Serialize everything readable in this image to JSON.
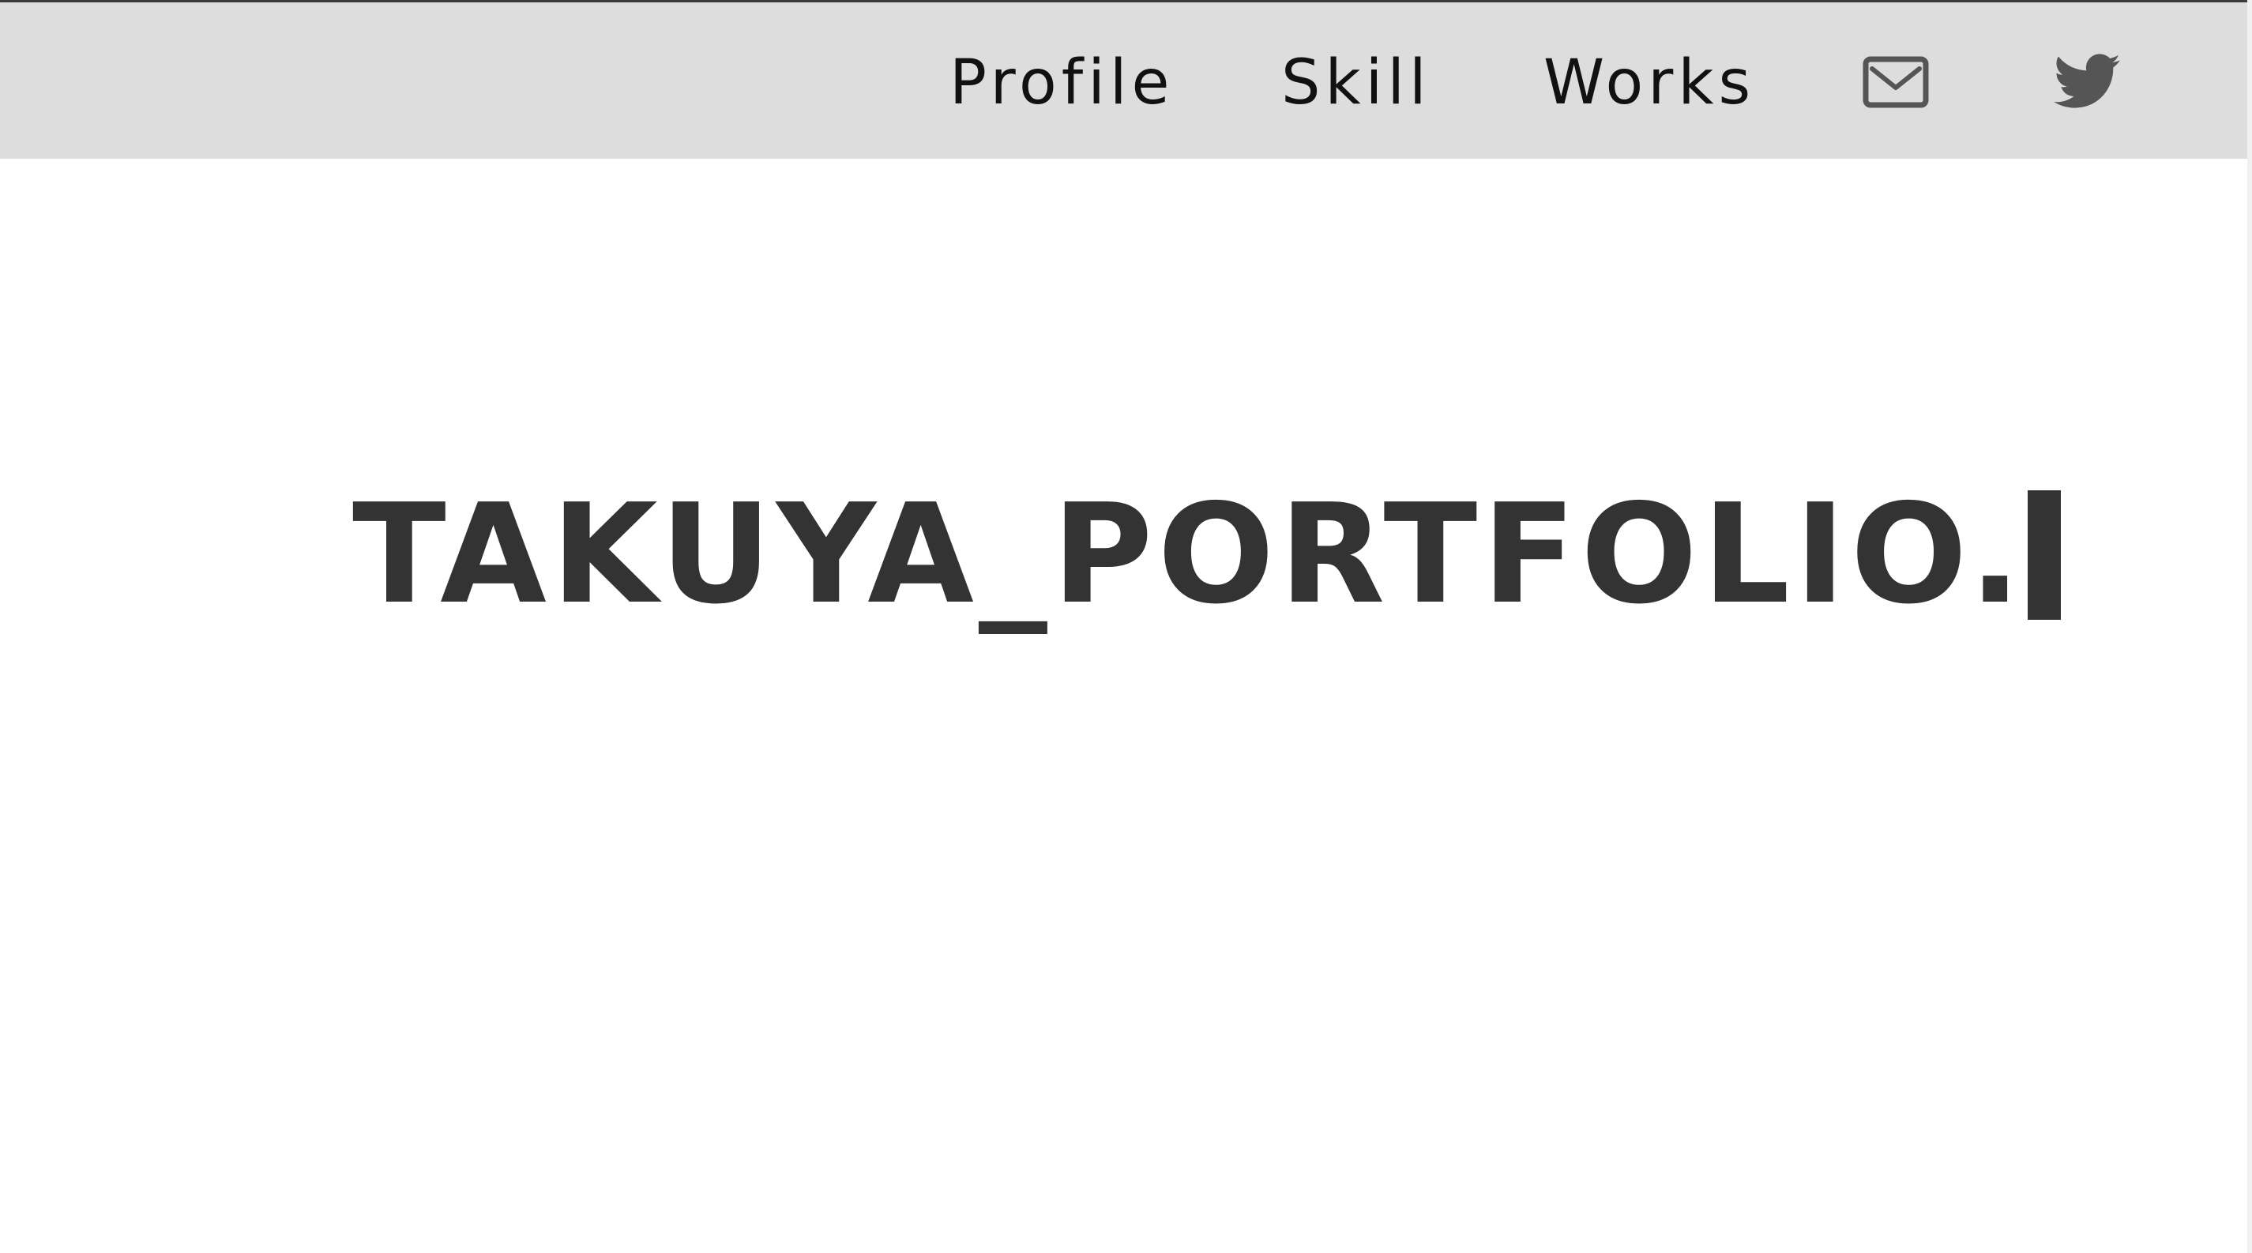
{
  "nav": {
    "links": [
      {
        "label": "Profile"
      },
      {
        "label": "Skill"
      },
      {
        "label": "Works"
      }
    ],
    "icons": {
      "mail": "mail-icon",
      "twitter": "twitter-icon"
    }
  },
  "hero": {
    "title": "TAKUYA_PORTFOLIO."
  },
  "colors": {
    "navbar_bg": "#dddddd",
    "text": "#333333",
    "icon": "#555555",
    "page_bg": "#ffffff"
  }
}
